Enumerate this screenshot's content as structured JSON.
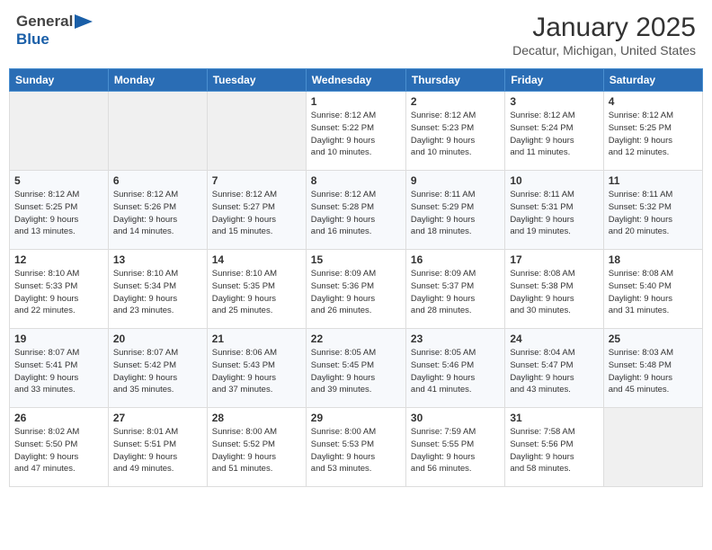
{
  "header": {
    "logo_general": "General",
    "logo_blue": "Blue",
    "month": "January 2025",
    "location": "Decatur, Michigan, United States"
  },
  "weekdays": [
    "Sunday",
    "Monday",
    "Tuesday",
    "Wednesday",
    "Thursday",
    "Friday",
    "Saturday"
  ],
  "weeks": [
    [
      {
        "day": "",
        "info": ""
      },
      {
        "day": "",
        "info": ""
      },
      {
        "day": "",
        "info": ""
      },
      {
        "day": "1",
        "info": "Sunrise: 8:12 AM\nSunset: 5:22 PM\nDaylight: 9 hours\nand 10 minutes."
      },
      {
        "day": "2",
        "info": "Sunrise: 8:12 AM\nSunset: 5:23 PM\nDaylight: 9 hours\nand 10 minutes."
      },
      {
        "day": "3",
        "info": "Sunrise: 8:12 AM\nSunset: 5:24 PM\nDaylight: 9 hours\nand 11 minutes."
      },
      {
        "day": "4",
        "info": "Sunrise: 8:12 AM\nSunset: 5:25 PM\nDaylight: 9 hours\nand 12 minutes."
      }
    ],
    [
      {
        "day": "5",
        "info": "Sunrise: 8:12 AM\nSunset: 5:25 PM\nDaylight: 9 hours\nand 13 minutes."
      },
      {
        "day": "6",
        "info": "Sunrise: 8:12 AM\nSunset: 5:26 PM\nDaylight: 9 hours\nand 14 minutes."
      },
      {
        "day": "7",
        "info": "Sunrise: 8:12 AM\nSunset: 5:27 PM\nDaylight: 9 hours\nand 15 minutes."
      },
      {
        "day": "8",
        "info": "Sunrise: 8:12 AM\nSunset: 5:28 PM\nDaylight: 9 hours\nand 16 minutes."
      },
      {
        "day": "9",
        "info": "Sunrise: 8:11 AM\nSunset: 5:29 PM\nDaylight: 9 hours\nand 18 minutes."
      },
      {
        "day": "10",
        "info": "Sunrise: 8:11 AM\nSunset: 5:31 PM\nDaylight: 9 hours\nand 19 minutes."
      },
      {
        "day": "11",
        "info": "Sunrise: 8:11 AM\nSunset: 5:32 PM\nDaylight: 9 hours\nand 20 minutes."
      }
    ],
    [
      {
        "day": "12",
        "info": "Sunrise: 8:10 AM\nSunset: 5:33 PM\nDaylight: 9 hours\nand 22 minutes."
      },
      {
        "day": "13",
        "info": "Sunrise: 8:10 AM\nSunset: 5:34 PM\nDaylight: 9 hours\nand 23 minutes."
      },
      {
        "day": "14",
        "info": "Sunrise: 8:10 AM\nSunset: 5:35 PM\nDaylight: 9 hours\nand 25 minutes."
      },
      {
        "day": "15",
        "info": "Sunrise: 8:09 AM\nSunset: 5:36 PM\nDaylight: 9 hours\nand 26 minutes."
      },
      {
        "day": "16",
        "info": "Sunrise: 8:09 AM\nSunset: 5:37 PM\nDaylight: 9 hours\nand 28 minutes."
      },
      {
        "day": "17",
        "info": "Sunrise: 8:08 AM\nSunset: 5:38 PM\nDaylight: 9 hours\nand 30 minutes."
      },
      {
        "day": "18",
        "info": "Sunrise: 8:08 AM\nSunset: 5:40 PM\nDaylight: 9 hours\nand 31 minutes."
      }
    ],
    [
      {
        "day": "19",
        "info": "Sunrise: 8:07 AM\nSunset: 5:41 PM\nDaylight: 9 hours\nand 33 minutes."
      },
      {
        "day": "20",
        "info": "Sunrise: 8:07 AM\nSunset: 5:42 PM\nDaylight: 9 hours\nand 35 minutes."
      },
      {
        "day": "21",
        "info": "Sunrise: 8:06 AM\nSunset: 5:43 PM\nDaylight: 9 hours\nand 37 minutes."
      },
      {
        "day": "22",
        "info": "Sunrise: 8:05 AM\nSunset: 5:45 PM\nDaylight: 9 hours\nand 39 minutes."
      },
      {
        "day": "23",
        "info": "Sunrise: 8:05 AM\nSunset: 5:46 PM\nDaylight: 9 hours\nand 41 minutes."
      },
      {
        "day": "24",
        "info": "Sunrise: 8:04 AM\nSunset: 5:47 PM\nDaylight: 9 hours\nand 43 minutes."
      },
      {
        "day": "25",
        "info": "Sunrise: 8:03 AM\nSunset: 5:48 PM\nDaylight: 9 hours\nand 45 minutes."
      }
    ],
    [
      {
        "day": "26",
        "info": "Sunrise: 8:02 AM\nSunset: 5:50 PM\nDaylight: 9 hours\nand 47 minutes."
      },
      {
        "day": "27",
        "info": "Sunrise: 8:01 AM\nSunset: 5:51 PM\nDaylight: 9 hours\nand 49 minutes."
      },
      {
        "day": "28",
        "info": "Sunrise: 8:00 AM\nSunset: 5:52 PM\nDaylight: 9 hours\nand 51 minutes."
      },
      {
        "day": "29",
        "info": "Sunrise: 8:00 AM\nSunset: 5:53 PM\nDaylight: 9 hours\nand 53 minutes."
      },
      {
        "day": "30",
        "info": "Sunrise: 7:59 AM\nSunset: 5:55 PM\nDaylight: 9 hours\nand 56 minutes."
      },
      {
        "day": "31",
        "info": "Sunrise: 7:58 AM\nSunset: 5:56 PM\nDaylight: 9 hours\nand 58 minutes."
      },
      {
        "day": "",
        "info": ""
      }
    ]
  ]
}
